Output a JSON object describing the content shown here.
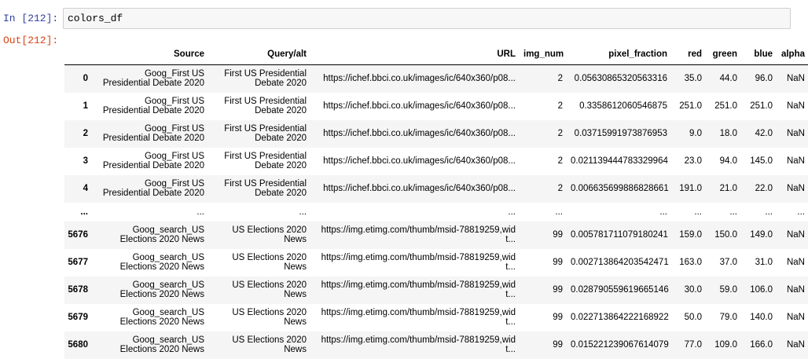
{
  "cell": {
    "in_prompt": "In [212]:",
    "out_prompt": "Out[212]:",
    "code": "colors_df"
  },
  "table": {
    "columns": [
      "",
      "Source",
      "Query/alt",
      "URL",
      "img_num",
      "pixel_fraction",
      "red",
      "green",
      "blue",
      "alpha"
    ],
    "rows": [
      [
        "0",
        "Goog_First US Presidential Debate 2020",
        "First US Presidential Debate 2020",
        "https://ichef.bbci.co.uk/images/ic/640x360/p08...",
        "2",
        "0.05630865320563316",
        "35.0",
        "44.0",
        "96.0",
        "NaN"
      ],
      [
        "1",
        "Goog_First US Presidential Debate 2020",
        "First US Presidential Debate 2020",
        "https://ichef.bbci.co.uk/images/ic/640x360/p08...",
        "2",
        "0.3358612060546875",
        "251.0",
        "251.0",
        "251.0",
        "NaN"
      ],
      [
        "2",
        "Goog_First US Presidential Debate 2020",
        "First US Presidential Debate 2020",
        "https://ichef.bbci.co.uk/images/ic/640x360/p08...",
        "2",
        "0.03715991973876953",
        "9.0",
        "18.0",
        "42.0",
        "NaN"
      ],
      [
        "3",
        "Goog_First US Presidential Debate 2020",
        "First US Presidential Debate 2020",
        "https://ichef.bbci.co.uk/images/ic/640x360/p08...",
        "2",
        "0.021139444783329964",
        "23.0",
        "94.0",
        "145.0",
        "NaN"
      ],
      [
        "4",
        "Goog_First US Presidential Debate 2020",
        "First US Presidential Debate 2020",
        "https://ichef.bbci.co.uk/images/ic/640x360/p08...",
        "2",
        "0.006635699886828661",
        "191.0",
        "21.0",
        "22.0",
        "NaN"
      ],
      [
        "...",
        "...",
        "...",
        "...",
        "...",
        "...",
        "...",
        "...",
        "...",
        "..."
      ],
      [
        "5676",
        "Goog_search_US Elections 2020 News",
        "US Elections 2020 News",
        "https://img.etimg.com/thumb/msid-78819259,widt...",
        "99",
        "0.005781711079180241",
        "159.0",
        "150.0",
        "149.0",
        "NaN"
      ],
      [
        "5677",
        "Goog_search_US Elections 2020 News",
        "US Elections 2020 News",
        "https://img.etimg.com/thumb/msid-78819259,widt...",
        "99",
        "0.002713864203542471",
        "163.0",
        "37.0",
        "31.0",
        "NaN"
      ],
      [
        "5678",
        "Goog_search_US Elections 2020 News",
        "US Elections 2020 News",
        "https://img.etimg.com/thumb/msid-78819259,widt...",
        "99",
        "0.028790559619665146",
        "30.0",
        "59.0",
        "106.0",
        "NaN"
      ],
      [
        "5679",
        "Goog_search_US Elections 2020 News",
        "US Elections 2020 News",
        "https://img.etimg.com/thumb/msid-78819259,widt...",
        "99",
        "0.022713864222168922",
        "50.0",
        "79.0",
        "140.0",
        "NaN"
      ],
      [
        "5680",
        "Goog_search_US Elections 2020 News",
        "US Elections 2020 News",
        "https://img.etimg.com/thumb/msid-78819259,widt...",
        "99",
        "0.015221239067614079",
        "77.0",
        "109.0",
        "166.0",
        "NaN"
      ]
    ]
  },
  "colors": {
    "in_prompt": "#303f9f",
    "out_prompt": "#d84315",
    "striped_row": "#f5f5f5",
    "input_bg": "#f7f7f7"
  }
}
